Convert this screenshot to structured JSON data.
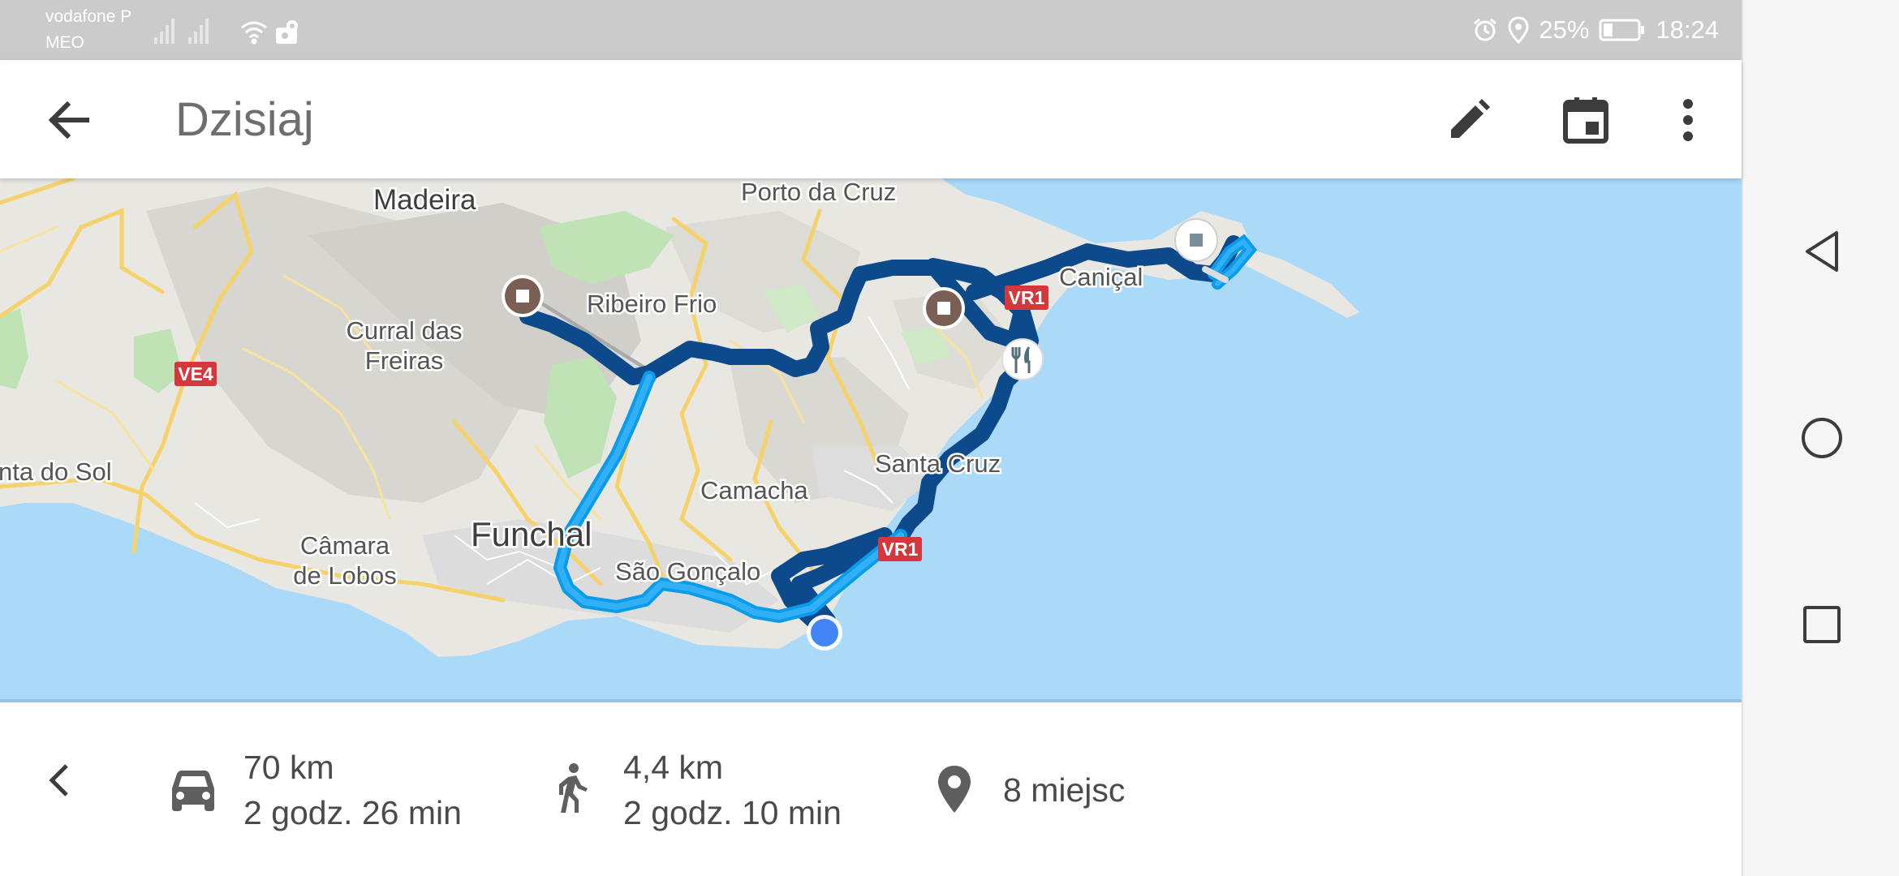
{
  "status_bar": {
    "carrier_1": "vodafone P",
    "carrier_2": "MEO",
    "battery": "25%",
    "time": "18:24",
    "icons": [
      "signal-icon",
      "signal-icon",
      "wifi-icon",
      "location-sharing-icon",
      "alarm-icon",
      "location-icon",
      "battery-icon"
    ]
  },
  "app_bar": {
    "title": "Dzisiaj",
    "icons": [
      "back-arrow-icon",
      "edit-pencil-icon",
      "calendar-icon",
      "more-vert-icon"
    ]
  },
  "map": {
    "labels": {
      "madeira": "Madeira",
      "porto_da_cruz": "Porto da Cruz",
      "ribeiro_frio": "Ribeiro Frio",
      "curral_1": "Curral das",
      "curral_2": "Freiras",
      "canical": "Caniçal",
      "santa_cruz": "Santa Cruz",
      "camacha": "Camacha",
      "funchal": "Funchal",
      "sao_goncalo": "São Gonçalo",
      "camara_1": "Câmara",
      "camara_2": "de Lobos",
      "ponta_do_sol": "nta do Sol"
    },
    "road_shields": {
      "ve4": "VE4",
      "vr1_top": "VR1",
      "vr1_bottom": "VR1"
    },
    "colors": {
      "water": "#abdaf9",
      "land": "#e9e7e2",
      "route_drive": "#0d4a8c",
      "route_walk": "#0a9be9",
      "current_location": "#4285f4",
      "place_marker": "#7b5e54"
    },
    "markers": [
      "place-marker-icon",
      "place-marker-icon",
      "place-marker-icon",
      "restaurant-icon",
      "current-location-dot"
    ]
  },
  "summary": {
    "drive_distance": "70 km",
    "drive_time": "2 godz. 26 min",
    "walk_distance": "4,4 km",
    "walk_time": "2 godz. 10 min",
    "places": "8 miejsc",
    "icons": [
      "chevron-left-icon",
      "car-icon",
      "walk-icon",
      "place-pin-icon"
    ]
  },
  "nav_bar": {
    "icons": [
      "back-triangle-icon",
      "home-circle-icon",
      "recents-square-icon"
    ]
  }
}
